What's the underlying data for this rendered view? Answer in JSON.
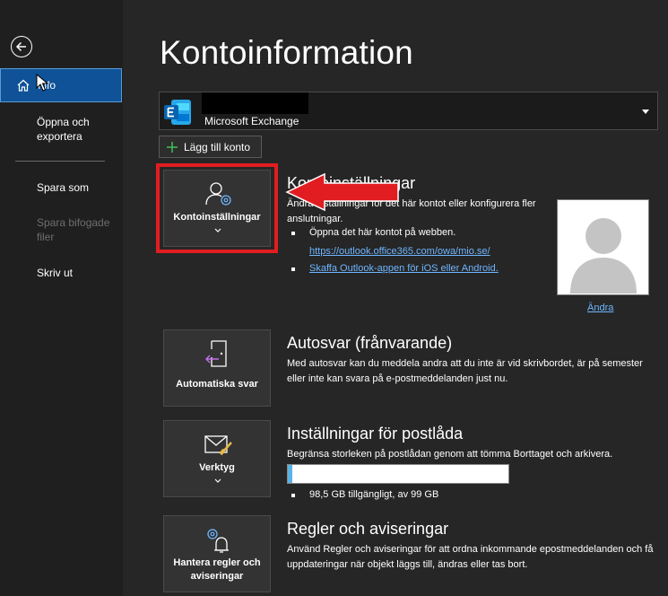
{
  "sidebar": {
    "items": [
      {
        "label": "Info"
      },
      {
        "label": "Öppna och exportera"
      },
      {
        "label": "Spara som"
      },
      {
        "label": "Spara bifogade filer"
      },
      {
        "label": "Skriv ut"
      }
    ]
  },
  "page": {
    "title": "Kontoinformation"
  },
  "account": {
    "type": "Microsoft Exchange"
  },
  "add_account": {
    "label": "Lägg till konto"
  },
  "account_settings": {
    "tile_label": "Kontoinställningar",
    "title": "Kontoinställningar",
    "desc": "Ändra inställningar för det här kontot eller konfigurera fler anslutningar.",
    "bullet1_text": "Öppna det här kontot på webben.",
    "bullet1_link": "https://outlook.office365.com/owa/mio.se/",
    "bullet2_link": "Skaffa Outlook-appen för iOS eller Android."
  },
  "avatar": {
    "change_label": "Ändra"
  },
  "auto_reply": {
    "tile_label": "Automatiska svar",
    "title": "Autosvar (frånvarande)",
    "desc": "Med autosvar kan du meddela andra att du inte är vid skrivbordet, är på semester eller inte kan svara på e-postmeddelanden just nu."
  },
  "mailbox": {
    "tile_label": "Verktyg",
    "title": "Inställningar för postlåda",
    "desc": "Begränsa storleken på postlådan genom att tömma Borttaget och arkivera.",
    "storage_text": "98,5 GB tillgängligt, av 99 GB",
    "used_fraction": 0.005
  },
  "rules": {
    "tile_label": "Hantera regler och aviseringar",
    "title": "Regler och aviseringar",
    "desc": "Använd Regler och aviseringar för att ordna inkommande epostmeddelanden och få uppdateringar när objekt läggs till, ändras eller tas bort."
  },
  "colors": {
    "accent": "#0f5297",
    "link": "#6fb6ff",
    "highlight": "#e11d21",
    "storage": "#5ab3e6"
  }
}
